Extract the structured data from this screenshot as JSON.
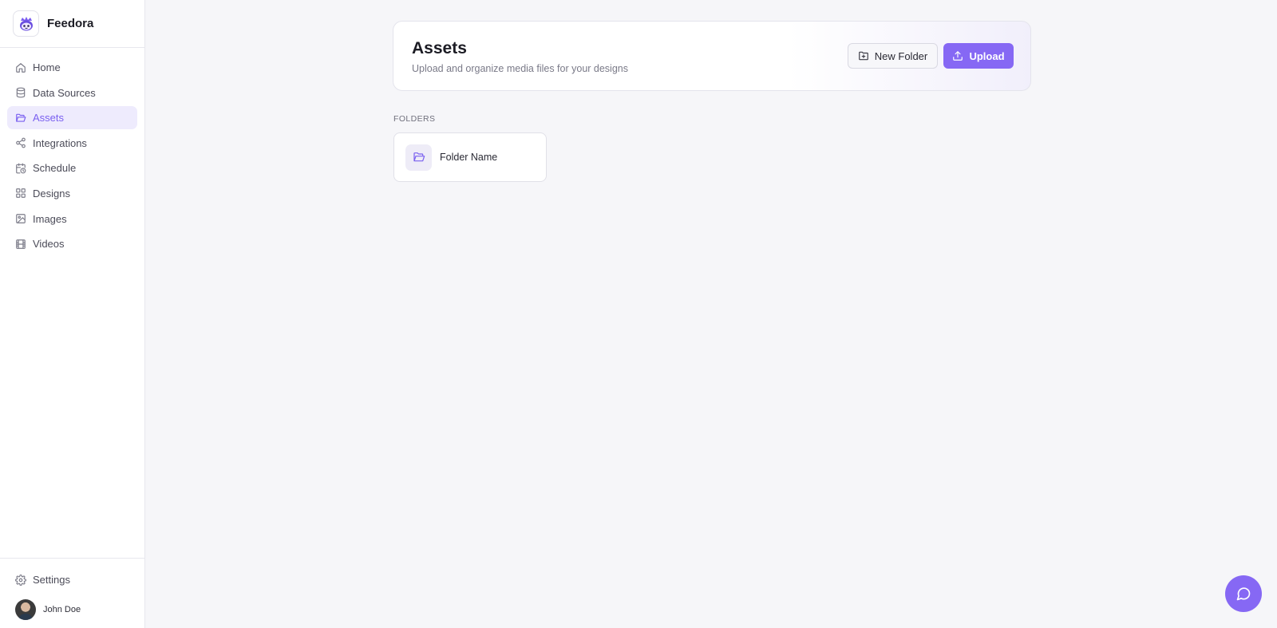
{
  "brand": {
    "name": "Feedora"
  },
  "sidebar": {
    "items": [
      {
        "label": "Home",
        "icon": "home-icon",
        "active": false
      },
      {
        "label": "Data Sources",
        "icon": "database-icon",
        "active": false
      },
      {
        "label": "Assets",
        "icon": "folder-open-icon",
        "active": true
      },
      {
        "label": "Integrations",
        "icon": "share-nodes-icon",
        "active": false
      },
      {
        "label": "Schedule",
        "icon": "calendar-clock-icon",
        "active": false
      },
      {
        "label": "Designs",
        "icon": "grid-icon",
        "active": false
      },
      {
        "label": "Images",
        "icon": "image-icon",
        "active": false
      },
      {
        "label": "Videos",
        "icon": "film-icon",
        "active": false
      }
    ],
    "settings_label": "Settings",
    "user_name": "John Doe"
  },
  "header": {
    "title": "Assets",
    "subtitle": "Upload and organize media files for your designs",
    "new_folder_label": "New Folder",
    "upload_label": "Upload"
  },
  "folders": {
    "section_label": "FOLDERS",
    "items": [
      {
        "name": "Folder Name"
      }
    ]
  },
  "colors": {
    "accent": "#8668f4",
    "active_bg": "#eeebfd",
    "active_text": "#7a60f0"
  }
}
